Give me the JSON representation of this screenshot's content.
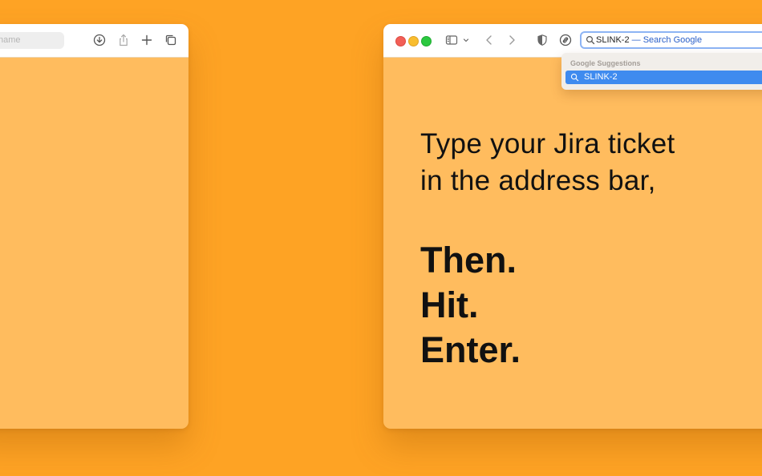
{
  "left_window": {
    "search_placeholder": "name",
    "toolbar_icons": [
      "download-icon",
      "share-icon",
      "plus-icon",
      "tabs-overview-icon"
    ]
  },
  "right_window": {
    "toolbar_icons": [
      "sidebar-icon",
      "chevron-down-icon",
      "back-icon",
      "forward-icon",
      "privacy-shield-icon",
      "extension-icon"
    ],
    "address_bar": {
      "query": "SLINK-2",
      "hint": " — Search Google"
    },
    "suggestions": {
      "heading": "Google Suggestions",
      "items": [
        "SLINK-2"
      ]
    },
    "content": {
      "line1": "Type your Jira ticket",
      "line2": "in the address bar,",
      "steps": [
        "Then.",
        "Hit.",
        "Enter."
      ]
    }
  },
  "colors": {
    "background": "#FEA324",
    "page": "#FFBC5E",
    "accent": "#3F8BEF"
  }
}
